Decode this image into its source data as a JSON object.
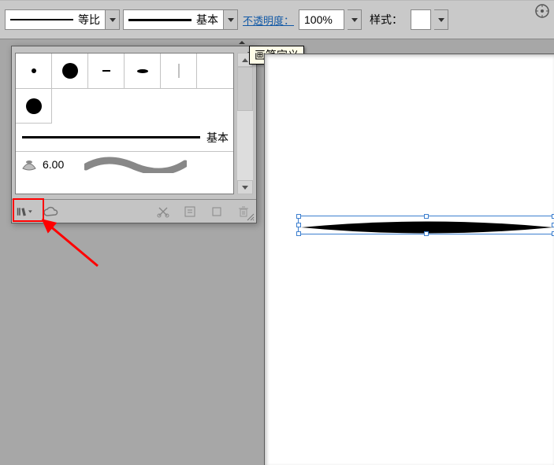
{
  "toolbar": {
    "scale_label": "等比",
    "basic_label": "基本",
    "opacity_label": "不透明度：",
    "opacity_value": "100%",
    "style_label": "样式："
  },
  "tooltip": "画笔定义",
  "panel": {
    "stroke_label": "基本",
    "ink_value": "6.00"
  }
}
